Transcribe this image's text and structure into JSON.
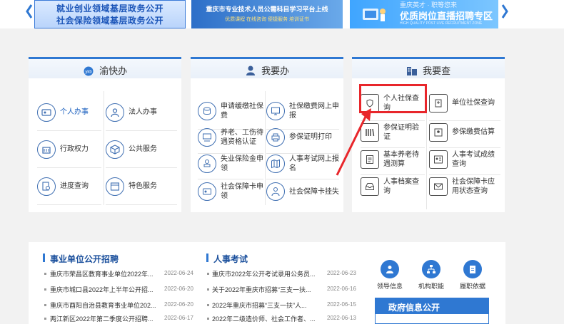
{
  "banners": {
    "b1_line1": "就业创业领域基层政务公开",
    "b1_line2": "社会保险领域基层政务公开",
    "b2_title": "重庆市专业技术人员公需科目学习平台上线",
    "b2_sub": "优质课程 在线咨询 便捷服务 培训证书",
    "b3_line1": "重庆英才 · 职等您来",
    "b3_line2": "优质岗位直播招聘专区",
    "b3_line3": "HIGH QUALITY POST LIVE RECRUITMENT ZONE"
  },
  "panels": {
    "p1": {
      "title": "渝快办",
      "items": [
        "个人办事",
        "法人办事",
        "行政权力",
        "公共服务",
        "进度查询",
        "特色服务"
      ]
    },
    "p2": {
      "title": "我要办",
      "items": [
        "申请缓缴社保费",
        "社保缴费网上申报",
        "养老、工伤待遇资格认证",
        "参保证明打印",
        "失业保险金申领",
        "人事考试网上报名",
        "社会保障卡申领",
        "社会保障卡挂失"
      ]
    },
    "p3": {
      "title": "我要查",
      "items": [
        "个人社保查询",
        "单位社保查询",
        "参保证明验证",
        "参保缴费估算",
        "基本养老待遇测算",
        "人事考试成绩查询",
        "人事档案查询",
        "社会保障卡应用状态查询"
      ]
    }
  },
  "bottom": {
    "recruit_title": "事业单位公开招聘",
    "exam_title": "人事考试",
    "recruit_news": [
      {
        "text": "重庆市荣昌区教育事业单位2022年...",
        "date": "2022-06-24"
      },
      {
        "text": "重庆市城口县2022年上半年公开招...",
        "date": "2022-06-20"
      },
      {
        "text": "重庆市酉阳自治县教育事业单位202...",
        "date": "2022-06-20"
      },
      {
        "text": "两江新区2022年第二季度公开招聘...",
        "date": "2022-06-17"
      }
    ],
    "exam_news": [
      {
        "text": "重庆市2022年公开考试录用公务员...",
        "date": "2022-06-23"
      },
      {
        "text": "关于2022年重庆市招募“三支一扶...",
        "date": "2022-06-16"
      },
      {
        "text": "2022年重庆市招募“三支一扶”人...",
        "date": "2022-06-15"
      },
      {
        "text": "2022年二级造价师、社会工作者、...",
        "date": "2022-06-13"
      }
    ],
    "quick_links": [
      "领导信息",
      "机构职能",
      "履职依据"
    ],
    "gov_title": "政府信息公开"
  },
  "colors": {
    "accent": "#2f78d2",
    "highlight": "#e8262b"
  }
}
